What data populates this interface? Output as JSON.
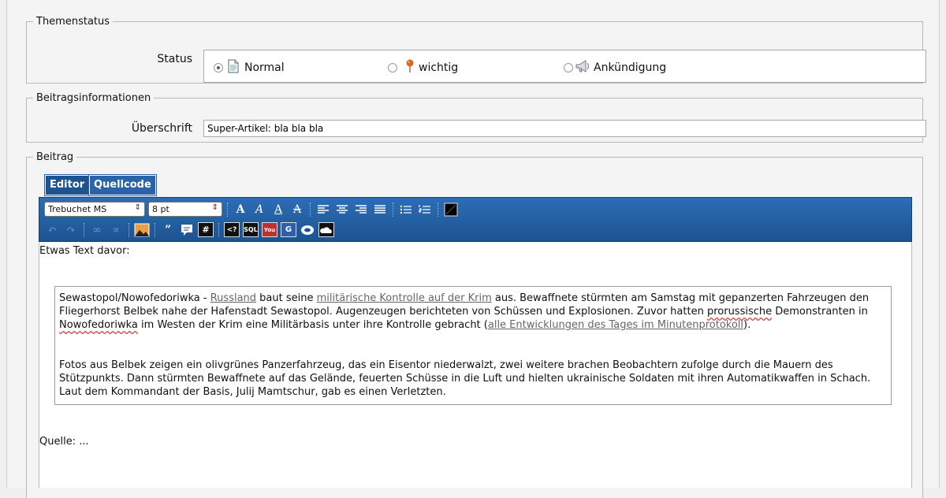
{
  "themenstatus": {
    "legend": "Themenstatus",
    "status_label": "Status",
    "options": [
      {
        "label": "Normal",
        "checked": true,
        "icon": "document-icon"
      },
      {
        "label": "wichtig",
        "checked": false,
        "icon": "pin-icon"
      },
      {
        "label": "Ankündigung",
        "checked": false,
        "icon": "megaphone-icon"
      }
    ]
  },
  "beitragsinfo": {
    "legend": "Beitragsinformationen",
    "heading_label": "Überschrift",
    "heading_value": "Super-Artikel: bla bla bla"
  },
  "beitrag": {
    "legend": "Beitrag",
    "tabs": [
      "Editor",
      "Quellcode"
    ],
    "active_tab": "Editor",
    "font_select": "Trebuchet MS",
    "size_select": "8 pt",
    "text_before": "Etwas Text davor:",
    "quote": {
      "p1": {
        "t1": "Sewastopol/Nowofedoriwka - ",
        "l1": "Russland",
        "t2": " baut seine ",
        "l2": "militärische Kontrolle auf der Krim",
        "t3": " aus. Bewaffnete stürmten am Samstag mit gepanzerten Fahrzeugen den Fliegerhorst Belbek nahe der Hafenstadt Sewastopol. Augenzeugen berichteten von Schüssen und Explosionen. Zuvor hatten ",
        "s1": "prorussische",
        "t4": " Demonstranten in ",
        "s2": "Nowofedoriwka",
        "t5": " im Westen der Krim eine Militärbasis unter ihre Kontrolle gebracht (",
        "l3": "alle Entwicklungen des Tages im Minutenprotokoll",
        "t6": ")."
      },
      "p2": "Fotos aus Belbek zeigen ein olivgrünes Panzerfahrzeug, das ein Eisentor niederwalzt, zwei weitere brachen Beobachtern zufolge durch die Mauern des Stützpunkts. Dann stürmten Bewaffnete auf das Gelände, feuerten Schüsse in die Luft und hielten ukrainische Soldaten mit ihren Automatikwaffen in Schach. Laut dem Kommandant der Basis, Julij Mamtschur, gab es einen Verletzten."
    },
    "text_after": "Quelle: ..."
  },
  "colors": {
    "toolbar": "#1c5391",
    "tab": "#2a64a8",
    "link": "#666666",
    "spellcheck": "#e04040"
  }
}
